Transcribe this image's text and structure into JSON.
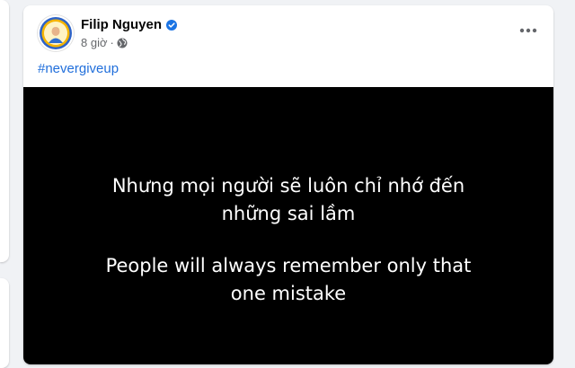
{
  "post": {
    "author_name": "Filip Nguyen",
    "verified": true,
    "timestamp": "8 giờ",
    "dot": "·",
    "privacy_icon": "globe-icon",
    "more_icon": "more-horizontal-icon",
    "hashtag": "#nevergiveup",
    "media": {
      "vi_lines": [
        "Nhưng mọi người sẽ luôn chỉ nhớ đến",
        "những sai lầm"
      ],
      "en_lines": [
        "People will always remember only that",
        "one mistake"
      ]
    }
  },
  "colors": {
    "link": "#216fdb",
    "verified": "#1b74e4",
    "media_bg": "#000000",
    "page_bg": "#f0f2f5"
  }
}
